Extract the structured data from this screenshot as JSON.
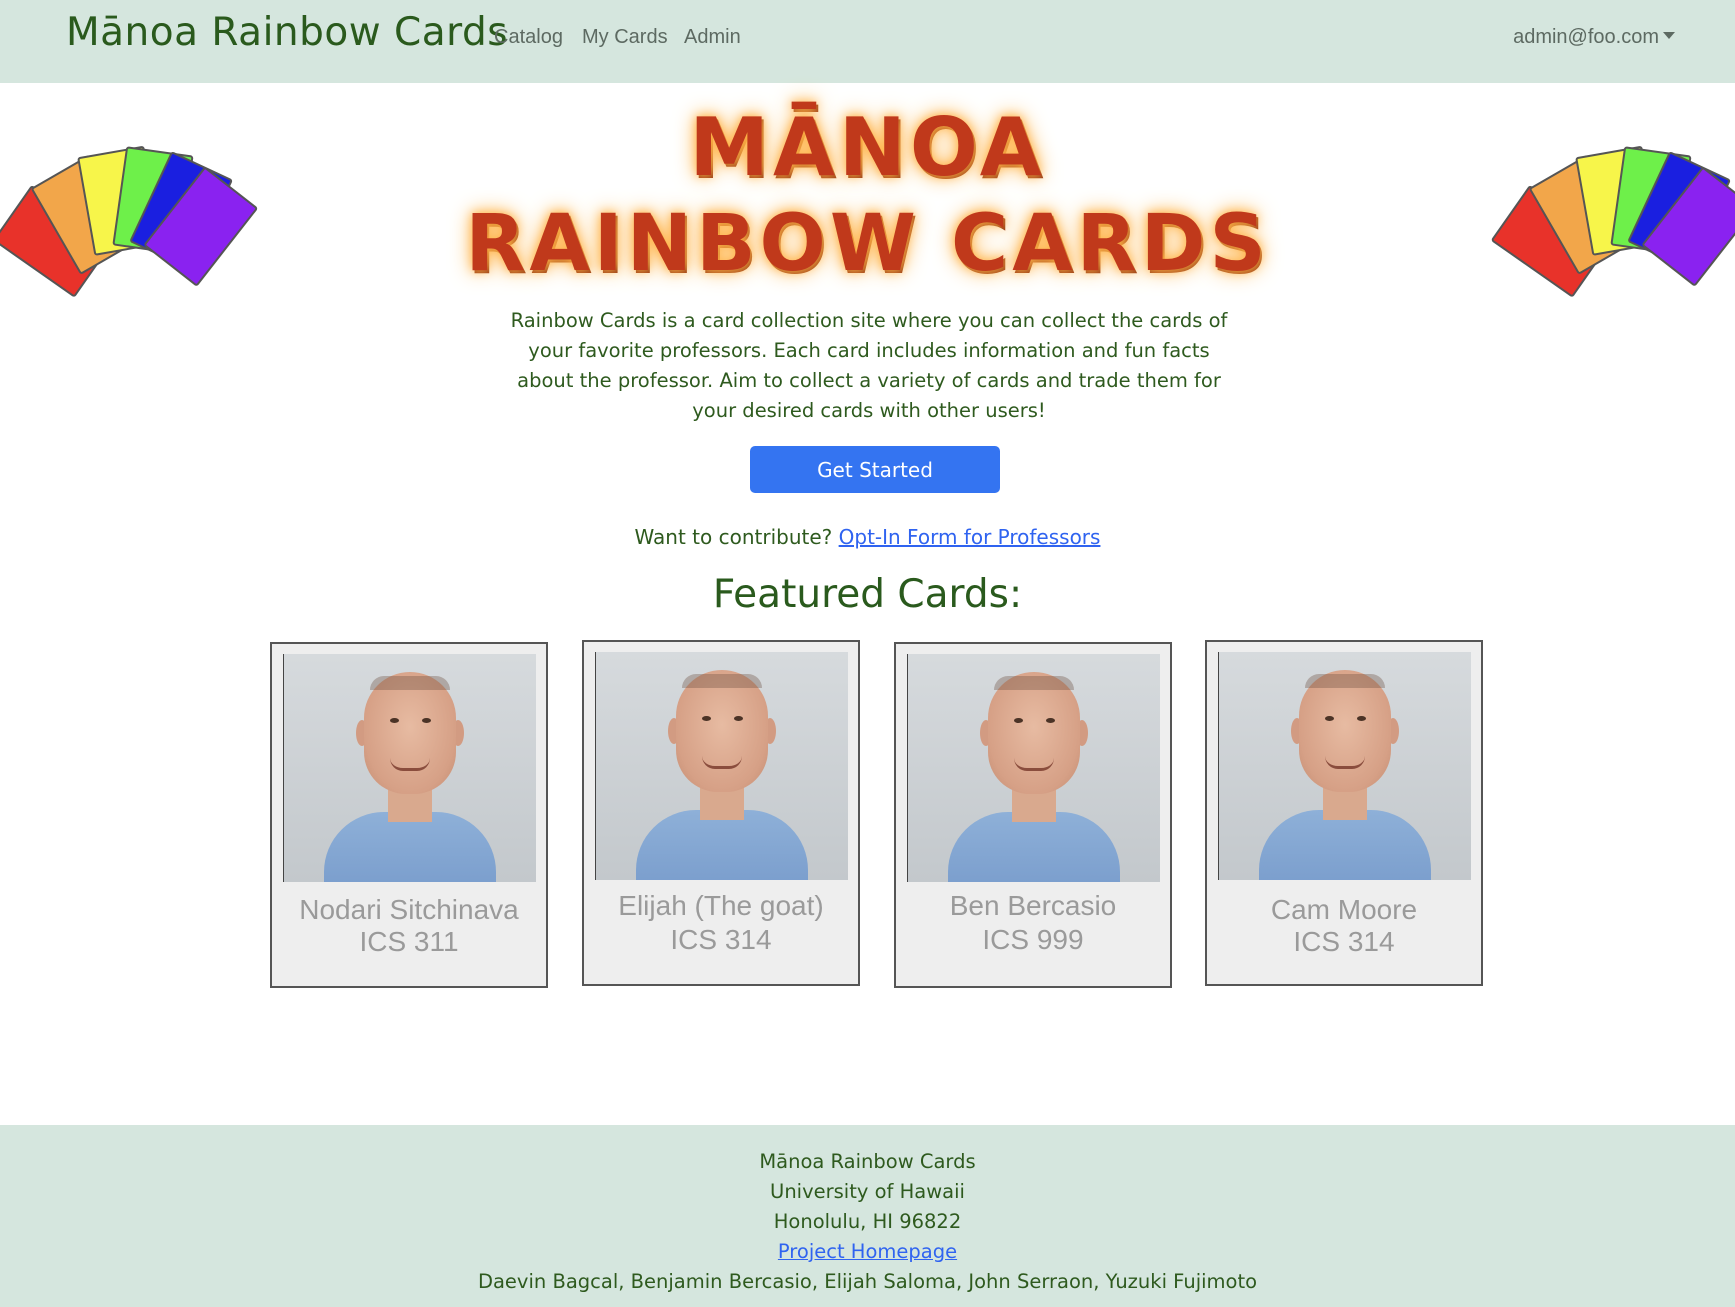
{
  "navbar": {
    "brand": "Mānoa Rainbow Cards",
    "links": [
      "Catalog",
      "My Cards",
      "Admin"
    ],
    "user": "admin@foo.com"
  },
  "hero": {
    "title_line1": "MĀNOA",
    "title_line2": "RAINBOW CARDS",
    "intro": "Rainbow Cards is a card collection site where you can collect the cards of your favorite professors. Each card includes information and fun facts about the professor. Aim to collect a variety of cards and trade them for your desired cards with other users!",
    "get_started": "Get Started",
    "contribute_prefix": "Want to contribute?",
    "contribute_link": "Opt-In Form for Professors"
  },
  "featured": {
    "title": "Featured Cards:",
    "cards": [
      {
        "name": "Nodari Sitchinava",
        "course": "ICS 311"
      },
      {
        "name": "Elijah (The goat)",
        "course": "ICS 314"
      },
      {
        "name": "Ben Bercasio",
        "course": "ICS 999"
      },
      {
        "name": "Cam Moore",
        "course": "ICS 314"
      }
    ]
  },
  "footer": {
    "line1": "Mānoa Rainbow Cards",
    "line2": "University of Hawaii",
    "line3": "Honolulu, HI 96822",
    "link": "Project Homepage",
    "authors": "Daevin Bagcal, Benjamin Bercasio, Elijah Saloma, John Serraon, Yuzuki Fujimoto"
  },
  "colors": {
    "navbar_bg": "#d5e6de",
    "text_green": "#2e5a1e",
    "button_blue": "#3474f1",
    "link_blue": "#2f63f0",
    "fan_cards": [
      "#e8322a",
      "#f2a64a",
      "#f7f54a",
      "#6ef04a",
      "#1a1fe0",
      "#8a22f0"
    ]
  },
  "icons": {
    "fan": "rainbow-card-fan-icon"
  }
}
